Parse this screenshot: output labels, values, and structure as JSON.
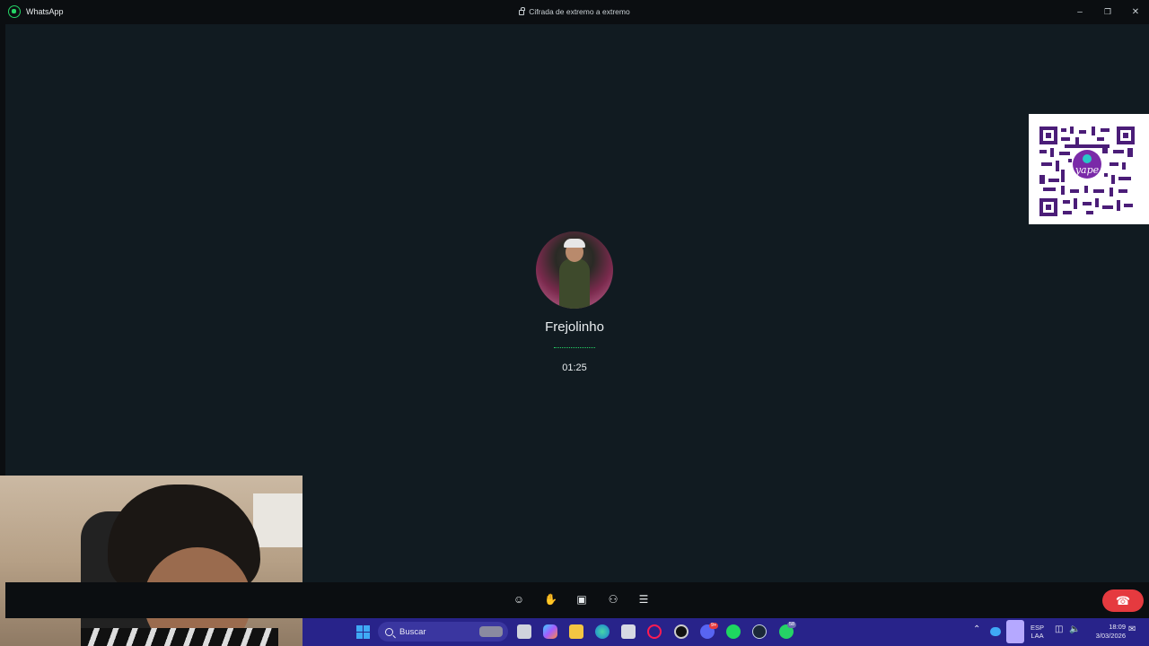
{
  "window": {
    "app_title": "WhatsApp",
    "encryption_label": "Cifrada de extremo a extremo",
    "minimize_icon": "minimize-icon",
    "restore_icon": "restore-icon",
    "close_icon": "close-icon"
  },
  "call": {
    "caller_name": "Frejolinho",
    "duration": "01:25",
    "status_indicator": "dots"
  },
  "controls": {
    "items": [
      {
        "name": "reactions-button",
        "icon": "emoji-icon",
        "glyph": "☺"
      },
      {
        "name": "raise-hand-button",
        "icon": "hand-icon",
        "glyph": "✋"
      },
      {
        "name": "share-screen-button",
        "icon": "screen-share-icon",
        "glyph": "▣"
      },
      {
        "name": "add-participant-button",
        "icon": "add-person-icon",
        "glyph": "⚇"
      },
      {
        "name": "chat-button",
        "icon": "chat-icon",
        "glyph": "☰"
      }
    ],
    "end_call_icon": "phone-hangup-icon",
    "end_call_glyph": "☎",
    "end_call_color": "#e53a3f"
  },
  "overlay": {
    "qr_brand": "yape"
  },
  "taskbar": {
    "search_placeholder": "Buscar",
    "language_line1": "ESP",
    "language_line2": "LAA",
    "time": "18:09",
    "date": "3/03/2026",
    "badge_discord": "9+",
    "badge_whatsapp": "58"
  },
  "colors": {
    "accent": "#25d366",
    "background": "#111b21",
    "taskbar": "#28238a"
  }
}
